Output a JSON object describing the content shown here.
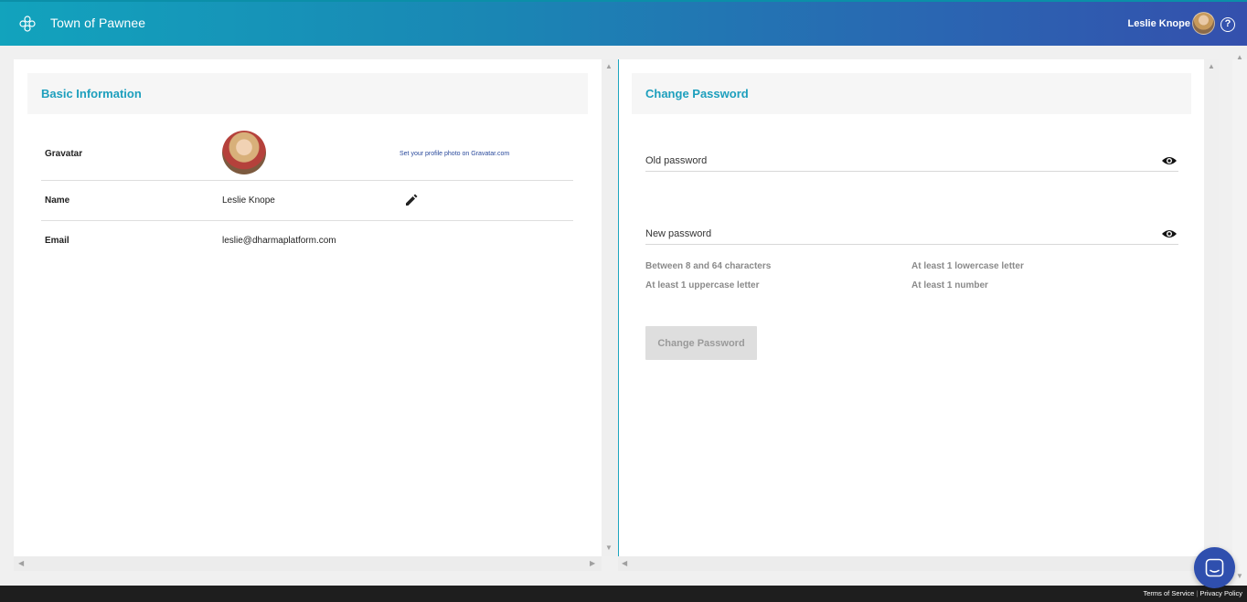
{
  "header": {
    "title": "Town of Pawnee",
    "user_name": "Leslie Knope",
    "help_label": "?"
  },
  "basic_info": {
    "heading": "Basic Information",
    "gravatar_label": "Gravatar",
    "gravatar_link": "Set your profile photo on Gravatar.com",
    "name_label": "Name",
    "name_value": "Leslie Knope",
    "email_label": "Email",
    "email_value": "leslie@dharmaplatform.com"
  },
  "change_password": {
    "heading": "Change Password",
    "old_password_placeholder": "Old password",
    "new_password_placeholder": "New password",
    "rules": [
      "Between 8 and 64 characters",
      "At least 1 lowercase letter",
      "At least 1 uppercase letter",
      "At least 1 number"
    ],
    "button_label": "Change Password"
  },
  "footer": {
    "terms": "Terms of Service",
    "separator": "|",
    "privacy": "Privacy Policy"
  },
  "colors": {
    "accent": "#1d9fbd",
    "header_start": "#12a3bd",
    "header_end": "#3450ad",
    "chat_button": "#2f4fae"
  }
}
